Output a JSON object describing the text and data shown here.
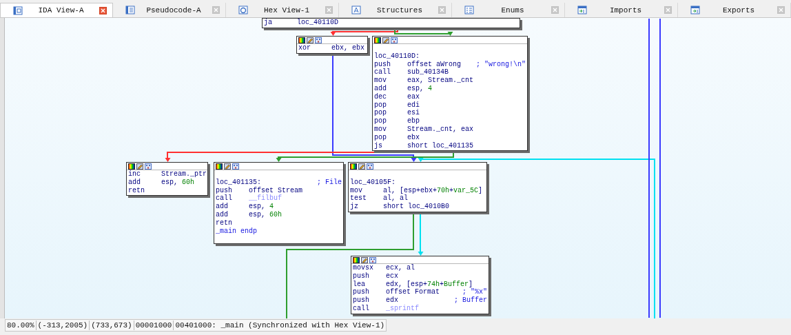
{
  "tabs": [
    {
      "label": "IDA View-A",
      "selected": true
    },
    {
      "label": "Pseudocode-A",
      "selected": false
    },
    {
      "label": "Hex View-1",
      "selected": false
    },
    {
      "label": "Structures",
      "selected": false
    },
    {
      "label": "Enums",
      "selected": false
    },
    {
      "label": "Imports",
      "selected": false
    },
    {
      "label": "Exports",
      "selected": false
    }
  ],
  "graph": {
    "edges": [
      {
        "color": "#ff3030"
      },
      {
        "color": "#2e9e2e"
      },
      {
        "color": "#3a3aff"
      },
      {
        "color": "#ff3030"
      },
      {
        "color": "#2e9e2e"
      },
      {
        "color": "#00e0f0"
      },
      {
        "color": "#2e9e2e"
      },
      {
        "color": "#00e0f0"
      },
      {
        "color": "#3a3aff"
      },
      {
        "color": "#3a3aff"
      }
    ],
    "nodes": [
      {
        "lines": [
          {
            "kind": "insn",
            "mnemonic": "ja",
            "operands": [
              {
                "text": "loc_40110D",
                "kind": "plain"
              }
            ]
          }
        ]
      },
      {
        "lines": [
          {
            "kind": "insn",
            "mnemonic": "xor",
            "operands": [
              {
                "text": "ebx, ebx",
                "kind": "plain"
              }
            ]
          }
        ]
      },
      {
        "lines": [
          {
            "kind": "label",
            "text": "loc_40110D:"
          },
          {
            "kind": "insn",
            "mnemonic": "push",
            "operands": [
              {
                "text": "offset aWrong",
                "kind": "plain"
              }
            ],
            "comment": "; \"wrong!\\n\""
          },
          {
            "kind": "insn",
            "mnemonic": "call",
            "operands": [
              {
                "text": "sub_40134B",
                "kind": "plain"
              }
            ]
          },
          {
            "kind": "insn",
            "mnemonic": "mov",
            "operands": [
              {
                "text": "eax, Stream._cnt",
                "kind": "plain"
              }
            ]
          },
          {
            "kind": "insn",
            "mnemonic": "add",
            "operands": [
              {
                "text": "esp, ",
                "kind": "plain"
              },
              {
                "text": "4",
                "kind": "number"
              }
            ]
          },
          {
            "kind": "insn",
            "mnemonic": "dec",
            "operands": [
              {
                "text": "eax",
                "kind": "plain"
              }
            ]
          },
          {
            "kind": "insn",
            "mnemonic": "pop",
            "operands": [
              {
                "text": "edi",
                "kind": "plain"
              }
            ]
          },
          {
            "kind": "insn",
            "mnemonic": "pop",
            "operands": [
              {
                "text": "esi",
                "kind": "plain"
              }
            ]
          },
          {
            "kind": "insn",
            "mnemonic": "pop",
            "operands": [
              {
                "text": "ebp",
                "kind": "plain"
              }
            ]
          },
          {
            "kind": "insn",
            "mnemonic": "mov",
            "operands": [
              {
                "text": "Stream._cnt, eax",
                "kind": "plain"
              }
            ]
          },
          {
            "kind": "insn",
            "mnemonic": "pop",
            "operands": [
              {
                "text": "ebx",
                "kind": "plain"
              }
            ]
          },
          {
            "kind": "insn",
            "mnemonic": "js",
            "operands": [
              {
                "text": "short loc_401135",
                "kind": "plain"
              }
            ]
          }
        ]
      },
      {
        "lines": [
          {
            "kind": "insn",
            "mnemonic": "inc",
            "operands": [
              {
                "text": "Stream._ptr",
                "kind": "plain"
              }
            ]
          },
          {
            "kind": "insn",
            "mnemonic": "add",
            "operands": [
              {
                "text": "esp, ",
                "kind": "plain"
              },
              {
                "text": "60h",
                "kind": "number"
              }
            ]
          },
          {
            "kind": "insn",
            "mnemonic": "retn"
          }
        ]
      },
      {
        "lines": [
          {
            "kind": "label",
            "text": "loc_401135:",
            "comment": "; File"
          },
          {
            "kind": "insn",
            "mnemonic": "push",
            "operands": [
              {
                "text": "offset Stream",
                "kind": "plain"
              }
            ]
          },
          {
            "kind": "insn",
            "mnemonic": "call",
            "operands": [
              {
                "text": "__filbuf",
                "kind": "function"
              }
            ]
          },
          {
            "kind": "insn",
            "mnemonic": "add",
            "operands": [
              {
                "text": "esp, ",
                "kind": "plain"
              },
              {
                "text": "4",
                "kind": "number"
              }
            ]
          },
          {
            "kind": "insn",
            "mnemonic": "add",
            "operands": [
              {
                "text": "esp, ",
                "kind": "plain"
              },
              {
                "text": "60h",
                "kind": "number"
              }
            ]
          },
          {
            "kind": "insn",
            "mnemonic": "retn"
          },
          {
            "kind": "end",
            "text": "_main endp"
          }
        ]
      },
      {
        "lines": [
          {
            "kind": "label",
            "text": "loc_40105F:"
          },
          {
            "kind": "insn",
            "mnemonic": "mov",
            "operands": [
              {
                "text": "al, [esp+ebx+",
                "kind": "plain"
              },
              {
                "text": "70h",
                "kind": "number"
              },
              {
                "text": "+",
                "kind": "plain"
              },
              {
                "text": "var_5C",
                "kind": "number"
              },
              {
                "text": "]",
                "kind": "plain"
              }
            ]
          },
          {
            "kind": "insn",
            "mnemonic": "test",
            "operands": [
              {
                "text": "al, al",
                "kind": "plain"
              }
            ]
          },
          {
            "kind": "insn",
            "mnemonic": "jz",
            "operands": [
              {
                "text": "short loc_4010B0",
                "kind": "plain"
              }
            ]
          }
        ]
      },
      {
        "lines": [
          {
            "kind": "insn",
            "mnemonic": "movsx",
            "operands": [
              {
                "text": "ecx, al",
                "kind": "plain"
              }
            ]
          },
          {
            "kind": "insn",
            "mnemonic": "push",
            "operands": [
              {
                "text": "ecx",
                "kind": "plain"
              }
            ]
          },
          {
            "kind": "insn",
            "mnemonic": "lea",
            "operands": [
              {
                "text": "edx, [esp+",
                "kind": "plain"
              },
              {
                "text": "74h",
                "kind": "number"
              },
              {
                "text": "+",
                "kind": "plain"
              },
              {
                "text": "Buffer",
                "kind": "number"
              },
              {
                "text": "]",
                "kind": "plain"
              }
            ]
          },
          {
            "kind": "insn",
            "mnemonic": "push",
            "operands": [
              {
                "text": "offset Format",
                "kind": "plain"
              }
            ],
            "comment": "; \"%x\""
          },
          {
            "kind": "insn",
            "mnemonic": "push",
            "operands": [
              {
                "text": "edx",
                "kind": "plain"
              }
            ],
            "comment": "; Buffer"
          },
          {
            "kind": "insn",
            "mnemonic": "call",
            "operands": [
              {
                "text": "_sprintf",
                "kind": "function"
              }
            ]
          }
        ]
      }
    ]
  },
  "status_bar": [
    "80.00%",
    "(-313,2005)",
    "(733,673)",
    "00001000",
    "00401000: _main (Synchronized with Hex View-1)"
  ]
}
